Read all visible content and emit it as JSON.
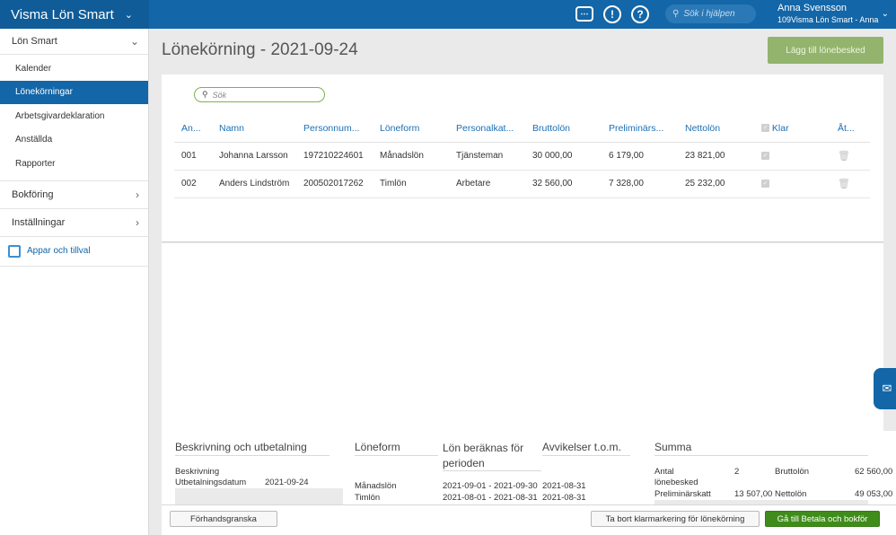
{
  "topbar": {
    "app_name": "Visma Lön Smart",
    "search_placeholder": "Sök i hjälpen",
    "user_name": "Anna Svensson",
    "user_company": "109Visma Lön Smart - Anna",
    "icons": [
      "chat-icon",
      "alert-icon",
      "help-icon"
    ]
  },
  "sidebar": {
    "section_main": "Lön Smart",
    "items": [
      "Kalender",
      "Lönekörningar",
      "Arbetsgivardeklaration",
      "Anställda",
      "Rapporter"
    ],
    "bokforing": "Bokföring",
    "installningar": "Inställningar",
    "apps": "Appar och tillval"
  },
  "main": {
    "title": "Lönekörning - 2021-09-24",
    "add_button": "Lägg till lönebesked",
    "search_placeholder": "Sök",
    "columns": [
      "An...",
      "Namn",
      "Personnum...",
      "Löneform",
      "Personalkat...",
      "Bruttolön",
      "Preliminärs...",
      "Nettolön",
      "Klar",
      "Åt..."
    ],
    "rows": [
      {
        "nr": "001",
        "name": "Johanna Larsson",
        "pnr": "197210224601",
        "form": "Månadslön",
        "cat": "Tjänsteman",
        "brutto": "30 000,00",
        "prelim": "6 179,00",
        "netto": "23 821,00"
      },
      {
        "nr": "002",
        "name": "Anders Lindström",
        "pnr": "200502017262",
        "form": "Timlön",
        "cat": "Arbetare",
        "brutto": "32 560,00",
        "prelim": "7 328,00",
        "netto": "25 232,00"
      }
    ]
  },
  "summary": {
    "h_desc": "Beskrivning och utbetalning",
    "desc_label": "Beskrivning",
    "pay_label": "Utbetalningsdatum",
    "pay_value": "2021-09-24",
    "h_form": "Löneform",
    "h_period": "Lön beräknas för perioden",
    "h_dev": "Avvikelser t.o.m.",
    "forms": [
      {
        "form": "Månadslön",
        "period": "2021-09-01 - 2021-09-30",
        "dev": "2021-08-31"
      },
      {
        "form": "Timlön",
        "period": "2021-08-01 - 2021-08-31",
        "dev": "2021-08-31"
      }
    ],
    "h_sum": "Summa",
    "antal_label": "Antal lönebesked",
    "antal_value": "2",
    "brutto_label": "Bruttolön",
    "brutto_value": "62 560,00",
    "prelim_label": "Preliminärskatt",
    "prelim_value": "13 507,00",
    "netto_label": "Nettolön",
    "netto_value": "49 053,00"
  },
  "footer": {
    "preview": "Förhandsgranska",
    "remove_mark": "Ta bort klarmarkering för lönekörning",
    "go_pay": "Gå till Betala och bokför"
  }
}
